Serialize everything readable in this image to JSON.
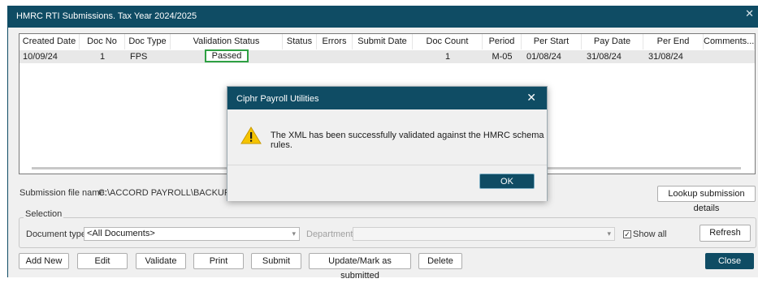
{
  "window": {
    "title": "HMRC RTI Submissions. Tax Year 2024/2025",
    "close_glyph": "✕"
  },
  "grid": {
    "columns": [
      "Created Date",
      "Doc No",
      "Doc Type",
      "Validation Status",
      "Status",
      "Errors",
      "Submit Date",
      "Doc Count",
      "Period",
      "Per Start",
      "Pay Date",
      "Per End",
      "Comments..."
    ],
    "row": {
      "created_date": "10/09/24",
      "doc_no": "1",
      "doc_type": "FPS",
      "validation_status": "Passed",
      "status": "",
      "errors": "",
      "submit_date": "",
      "doc_count": "1",
      "period": "M-05",
      "per_start": "01/08/24",
      "pay_date": "31/08/24",
      "per_end": "31/08/24",
      "comments": ""
    },
    "highlight_color": "#2ea043"
  },
  "submission": {
    "label": "Submission file name:",
    "value": "C:\\ACCORD PAYROLL\\BACKUP\\01XM",
    "lookup_button": "Lookup submission details"
  },
  "selection": {
    "legend": "Selection",
    "doc_types_label": "Document types:",
    "doc_types_value": "<All Documents>",
    "departments_label": "Departments:",
    "departments_value": "",
    "show_all_label": "Show all",
    "show_all_checked": true,
    "refresh_button": "Refresh"
  },
  "actions": {
    "add_new": "Add New",
    "edit": "Edit",
    "validate": "Validate",
    "print": "Print",
    "submit": "Submit",
    "update_mark": "Update/Mark as submitted",
    "delete": "Delete",
    "close": "Close"
  },
  "dialog": {
    "title": "Ciphr Payroll Utilities",
    "message": "The XML has been successfully validated against the HMRC schema rules.",
    "ok_button": "OK",
    "icon": "warning-icon"
  },
  "colors": {
    "brand": "#0f4c64",
    "warning": "#f5c400"
  }
}
